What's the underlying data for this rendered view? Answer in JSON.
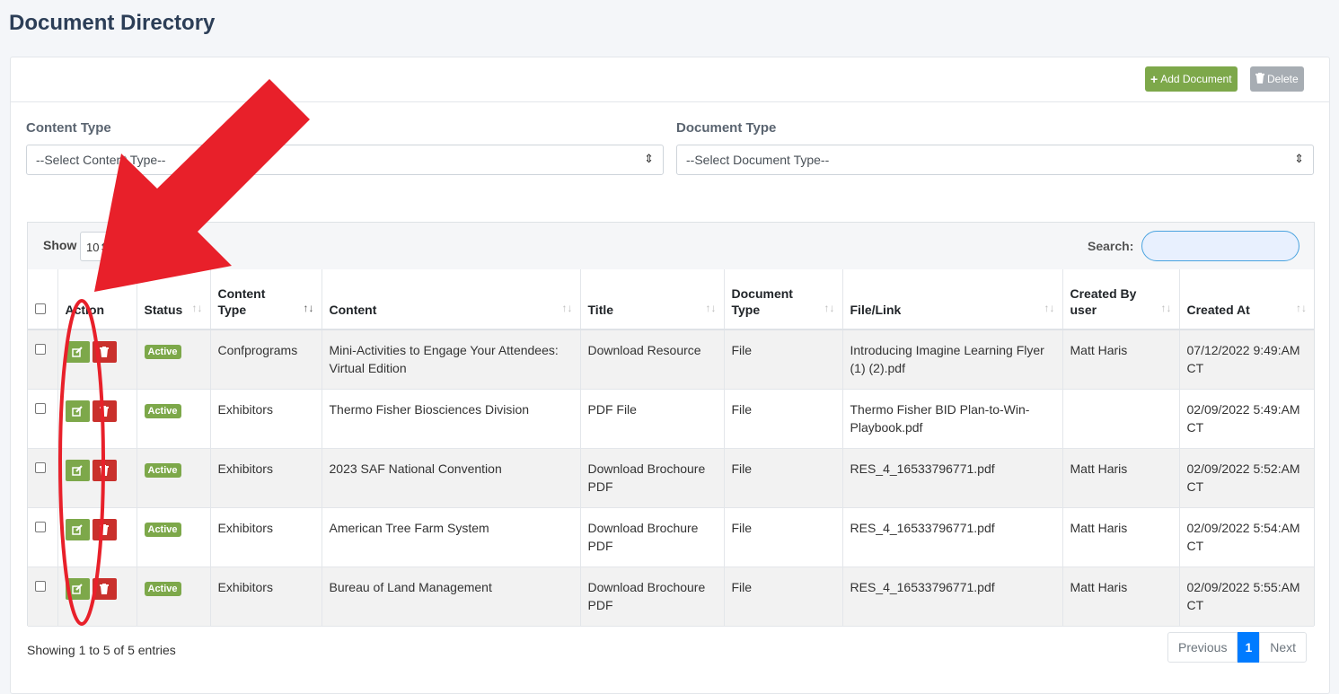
{
  "page_title": "Document Directory",
  "toolbar": {
    "add_label": "Add Document",
    "delete_label": "Delete"
  },
  "filters": {
    "content_type_label": "Content Type",
    "content_type_value": "--Select Content Type--",
    "document_type_label": "Document Type",
    "document_type_value": "--Select Document Type--"
  },
  "table_controls": {
    "show_label": "Show",
    "show_value": "10",
    "search_label": "Search:"
  },
  "columns": [
    "Action",
    "Status",
    "Content Type",
    "Content",
    "Title",
    "Document Type",
    "File/Link",
    "Created By user",
    "Created At"
  ],
  "rows": [
    {
      "status": "Active",
      "content_type": "Confprograms",
      "content": "Mini-Activities to Engage Your Attendees: Virtual Edition",
      "title": "Download Resource",
      "doc_type": "File",
      "file": "Introducing Imagine Learning Flyer (1) (2).pdf",
      "created_by": "Matt Haris",
      "created_at": "07/12/2022 9:49:AM CT"
    },
    {
      "status": "Active",
      "content_type": "Exhibitors",
      "content": "Thermo Fisher Biosciences Division",
      "title": "PDF File",
      "doc_type": "File",
      "file": "Thermo Fisher BID Plan-to-Win-Playbook.pdf",
      "created_by": "",
      "created_at": "02/09/2022 5:49:AM CT"
    },
    {
      "status": "Active",
      "content_type": "Exhibitors",
      "content": "2023 SAF National Convention",
      "title": "Download Brochoure PDF",
      "doc_type": "File",
      "file": "RES_4_16533796771.pdf",
      "created_by": "Matt Haris",
      "created_at": "02/09/2022 5:52:AM CT"
    },
    {
      "status": "Active",
      "content_type": "Exhibitors",
      "content": "American Tree Farm System",
      "title": "Download Brochure PDF",
      "doc_type": "File",
      "file": "RES_4_16533796771.pdf",
      "created_by": "Matt Haris",
      "created_at": "02/09/2022 5:54:AM CT"
    },
    {
      "status": "Active",
      "content_type": "Exhibitors",
      "content": "Bureau of Land Management",
      "title": "Download Brochoure PDF",
      "doc_type": "File",
      "file": "RES_4_16533796771.pdf",
      "created_by": "Matt Haris",
      "created_at": "02/09/2022 5:55:AM CT"
    }
  ],
  "footer": {
    "info": "Showing 1 to 5 of 5 entries",
    "prev": "Previous",
    "page": "1",
    "next": "Next"
  },
  "colors": {
    "accent_green": "#7da84a",
    "danger_red": "#c9302c",
    "annotation_red": "#e8202a",
    "primary_blue": "#007bff"
  }
}
